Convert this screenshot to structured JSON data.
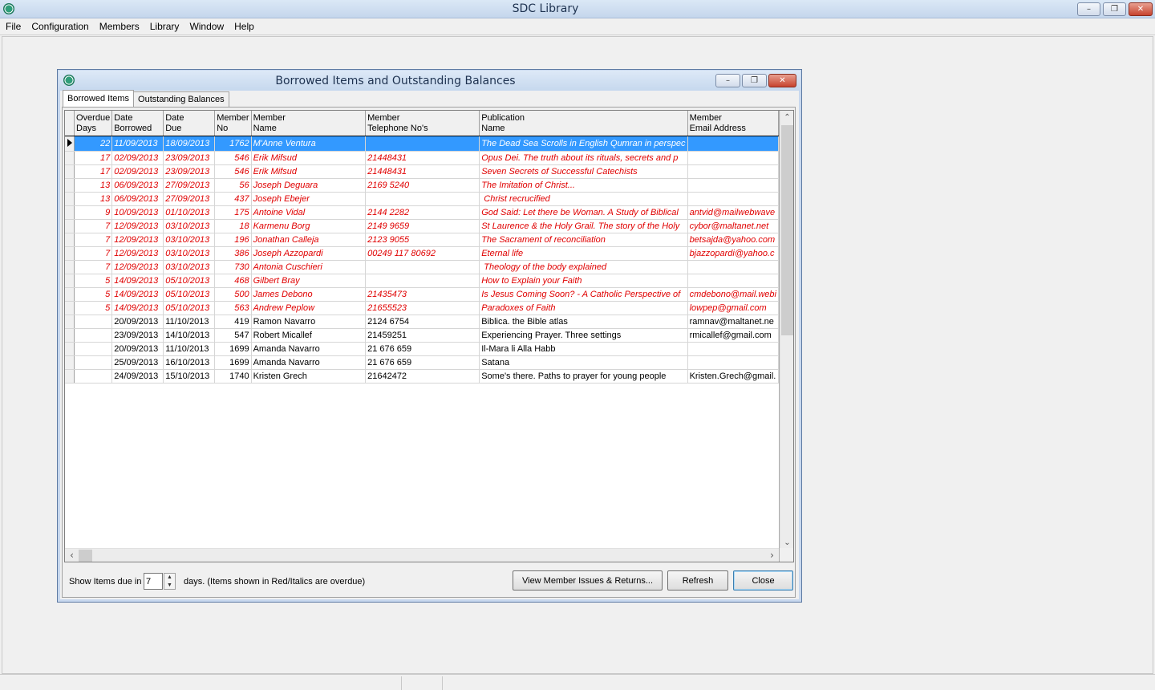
{
  "app": {
    "title": "SDC Library",
    "window_controls": {
      "minimize": "–",
      "maximize": "❐",
      "close": "✕"
    }
  },
  "menu": [
    "File",
    "Configuration",
    "Members",
    "Library",
    "Window",
    "Help"
  ],
  "dialog": {
    "title": "Borrowed Items and Outstanding Balances",
    "tabs": [
      "Borrowed Items",
      "Outstanding Balances"
    ],
    "active_tab": "Borrowed Items",
    "grid": {
      "columns": [
        {
          "key": "overdue",
          "label": "Overdue\nDays"
        },
        {
          "key": "borrowed",
          "label": "Date\nBorrowed"
        },
        {
          "key": "due",
          "label": "Date\nDue"
        },
        {
          "key": "member_no",
          "label": "Member\nNo"
        },
        {
          "key": "member_name",
          "label": "Member\nName"
        },
        {
          "key": "phone",
          "label": "Member\nTelephone No's"
        },
        {
          "key": "publication",
          "label": "Publication\nName"
        },
        {
          "key": "email",
          "label": "Member\nEmail Address"
        }
      ],
      "rows": [
        {
          "overdue": "22",
          "borrowed": "11/09/2013",
          "due": "18/09/2013",
          "member_no": "1762",
          "member_name": "M'Anne Ventura",
          "phone": "",
          "publication": "The Dead Sea Scrolls in English Qumran in perspec",
          "email": "",
          "is_overdue": true,
          "selected": true
        },
        {
          "overdue": "17",
          "borrowed": "02/09/2013",
          "due": "23/09/2013",
          "member_no": "546",
          "member_name": "Erik Mifsud",
          "phone": "21448431",
          "publication": "Opus Dei. The truth about its rituals, secrets and p",
          "email": "",
          "is_overdue": true
        },
        {
          "overdue": "17",
          "borrowed": "02/09/2013",
          "due": "23/09/2013",
          "member_no": "546",
          "member_name": "Erik Mifsud",
          "phone": "21448431",
          "publication": "Seven Secrets of Successful Catechists",
          "email": "",
          "is_overdue": true
        },
        {
          "overdue": "13",
          "borrowed": "06/09/2013",
          "due": "27/09/2013",
          "member_no": "56",
          "member_name": "Joseph Deguara",
          "phone": "2169 5240",
          "publication": "The Imitation of Christ...",
          "email": "",
          "is_overdue": true
        },
        {
          "overdue": "13",
          "borrowed": "06/09/2013",
          "due": "27/09/2013",
          "member_no": "437",
          "member_name": "Joseph Ebejer",
          "phone": "",
          "publication": " Christ recrucified",
          "email": "",
          "is_overdue": true
        },
        {
          "overdue": "9",
          "borrowed": "10/09/2013",
          "due": "01/10/2013",
          "member_no": "175",
          "member_name": "Antoine Vidal",
          "phone": "2144 2282",
          "publication": "God Said: Let there be Woman. A Study of Biblical",
          "email": "antvid@mailwebwave",
          "is_overdue": true
        },
        {
          "overdue": "7",
          "borrowed": "12/09/2013",
          "due": "03/10/2013",
          "member_no": "18",
          "member_name": "Karmenu Borg",
          "phone": "2149 9659",
          "publication": "St Laurence & the Holy Grail. The story of the Holy",
          "email": "cybor@maltanet.net",
          "is_overdue": true
        },
        {
          "overdue": "7",
          "borrowed": "12/09/2013",
          "due": "03/10/2013",
          "member_no": "196",
          "member_name": "Jonathan Calleja",
          "phone": "2123 9055",
          "publication": "The Sacrament of reconciliation",
          "email": "betsajda@yahoo.com",
          "is_overdue": true
        },
        {
          "overdue": "7",
          "borrowed": "12/09/2013",
          "due": "03/10/2013",
          "member_no": "386",
          "member_name": "Joseph Azzopardi",
          "phone": "00249 117 80692",
          "publication": "Eternal life",
          "email": "bjazzopardi@yahoo.c",
          "is_overdue": true
        },
        {
          "overdue": "7",
          "borrowed": "12/09/2013",
          "due": "03/10/2013",
          "member_no": "730",
          "member_name": "Antonia Cuschieri",
          "phone": "",
          "publication": " Theology of the body explained",
          "email": "",
          "is_overdue": true
        },
        {
          "overdue": "5",
          "borrowed": "14/09/2013",
          "due": "05/10/2013",
          "member_no": "468",
          "member_name": "Gilbert Bray",
          "phone": "",
          "publication": "How to Explain your Faith",
          "email": "",
          "is_overdue": true
        },
        {
          "overdue": "5",
          "borrowed": "14/09/2013",
          "due": "05/10/2013",
          "member_no": "500",
          "member_name": "James Debono",
          "phone": "21435473",
          "publication": "Is Jesus Coming Soon? - A Catholic Perspective of",
          "email": "cmdebono@mail.webi",
          "is_overdue": true
        },
        {
          "overdue": "5",
          "borrowed": "14/09/2013",
          "due": "05/10/2013",
          "member_no": "563",
          "member_name": "Andrew Peplow",
          "phone": "21655523",
          "publication": "Paradoxes of Faith",
          "email": "lowpep@gmail.com",
          "is_overdue": true
        },
        {
          "overdue": "",
          "borrowed": "20/09/2013",
          "due": "11/10/2013",
          "member_no": "419",
          "member_name": "Ramon Navarro",
          "phone": "2124 6754",
          "publication": "Biblica. the Bible atlas",
          "email": "ramnav@maltanet.ne",
          "is_overdue": false
        },
        {
          "overdue": "",
          "borrowed": "23/09/2013",
          "due": "14/10/2013",
          "member_no": "547",
          "member_name": "Robert Micallef",
          "phone": "21459251",
          "publication": "Experiencing Prayer. Three settings",
          "email": "rmicallef@gmail.com",
          "is_overdue": false
        },
        {
          "overdue": "",
          "borrowed": "20/09/2013",
          "due": "11/10/2013",
          "member_no": "1699",
          "member_name": "Amanda Navarro",
          "phone": "21 676 659",
          "publication": "Il-Mara li Alla Habb",
          "email": "",
          "is_overdue": false
        },
        {
          "overdue": "",
          "borrowed": "25/09/2013",
          "due": "16/10/2013",
          "member_no": "1699",
          "member_name": "Amanda Navarro",
          "phone": "21 676 659",
          "publication": "Satana",
          "email": "",
          "is_overdue": false
        },
        {
          "overdue": "",
          "borrowed": "24/09/2013",
          "due": "15/10/2013",
          "member_no": "1740",
          "member_name": "Kristen Grech",
          "phone": "21642472",
          "publication": "Some's there. Paths to prayer for young people",
          "email": "Kristen.Grech@gmail.",
          "is_overdue": false
        }
      ]
    },
    "footer": {
      "show_label": "Show Items due in",
      "days_value": "7",
      "days_label": "days.  (Items shown in Red/Italics are overdue)",
      "view_button": "View Member Issues & Returns...",
      "refresh_button": "Refresh",
      "close_button": "Close"
    }
  }
}
